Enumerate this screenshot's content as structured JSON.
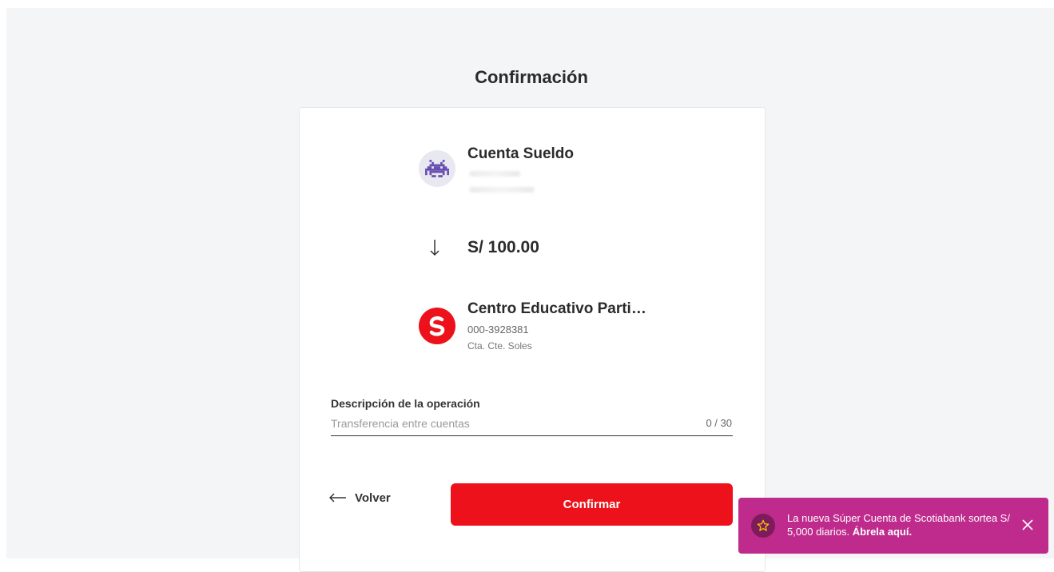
{
  "page": {
    "title": "Confirmación"
  },
  "origin": {
    "account_name": "Cuenta Sueldo",
    "avatar_icon": "space-invader-icon"
  },
  "transfer": {
    "amount": "S/ 100.00",
    "arrow_icon": "arrow-down-icon"
  },
  "destination": {
    "name": "Centro Educativo Parti…",
    "account_number": "000-3928381",
    "account_type": "Cta. Cte. Soles",
    "logo_icon": "scotiabank-logo-icon"
  },
  "description": {
    "label": "Descripción de la operación",
    "placeholder": "Transferencia entre cuentas",
    "value": "",
    "counter": "0 / 30"
  },
  "actions": {
    "back_label": "Volver",
    "confirm_label": "Confirmar"
  },
  "toast": {
    "text": "La nueva Súper Cuenta de Scotiabank sortea S/ 5,000 diarios.",
    "link_text": "Ábrela aquí.",
    "icon": "star-icon",
    "close_icon": "close-icon"
  },
  "colors": {
    "brand_red": "#ec111a",
    "toast_bg": "#be2b8c",
    "toast_icon_bg": "#7d1b5c",
    "page_bg": "#f4f5f7"
  }
}
